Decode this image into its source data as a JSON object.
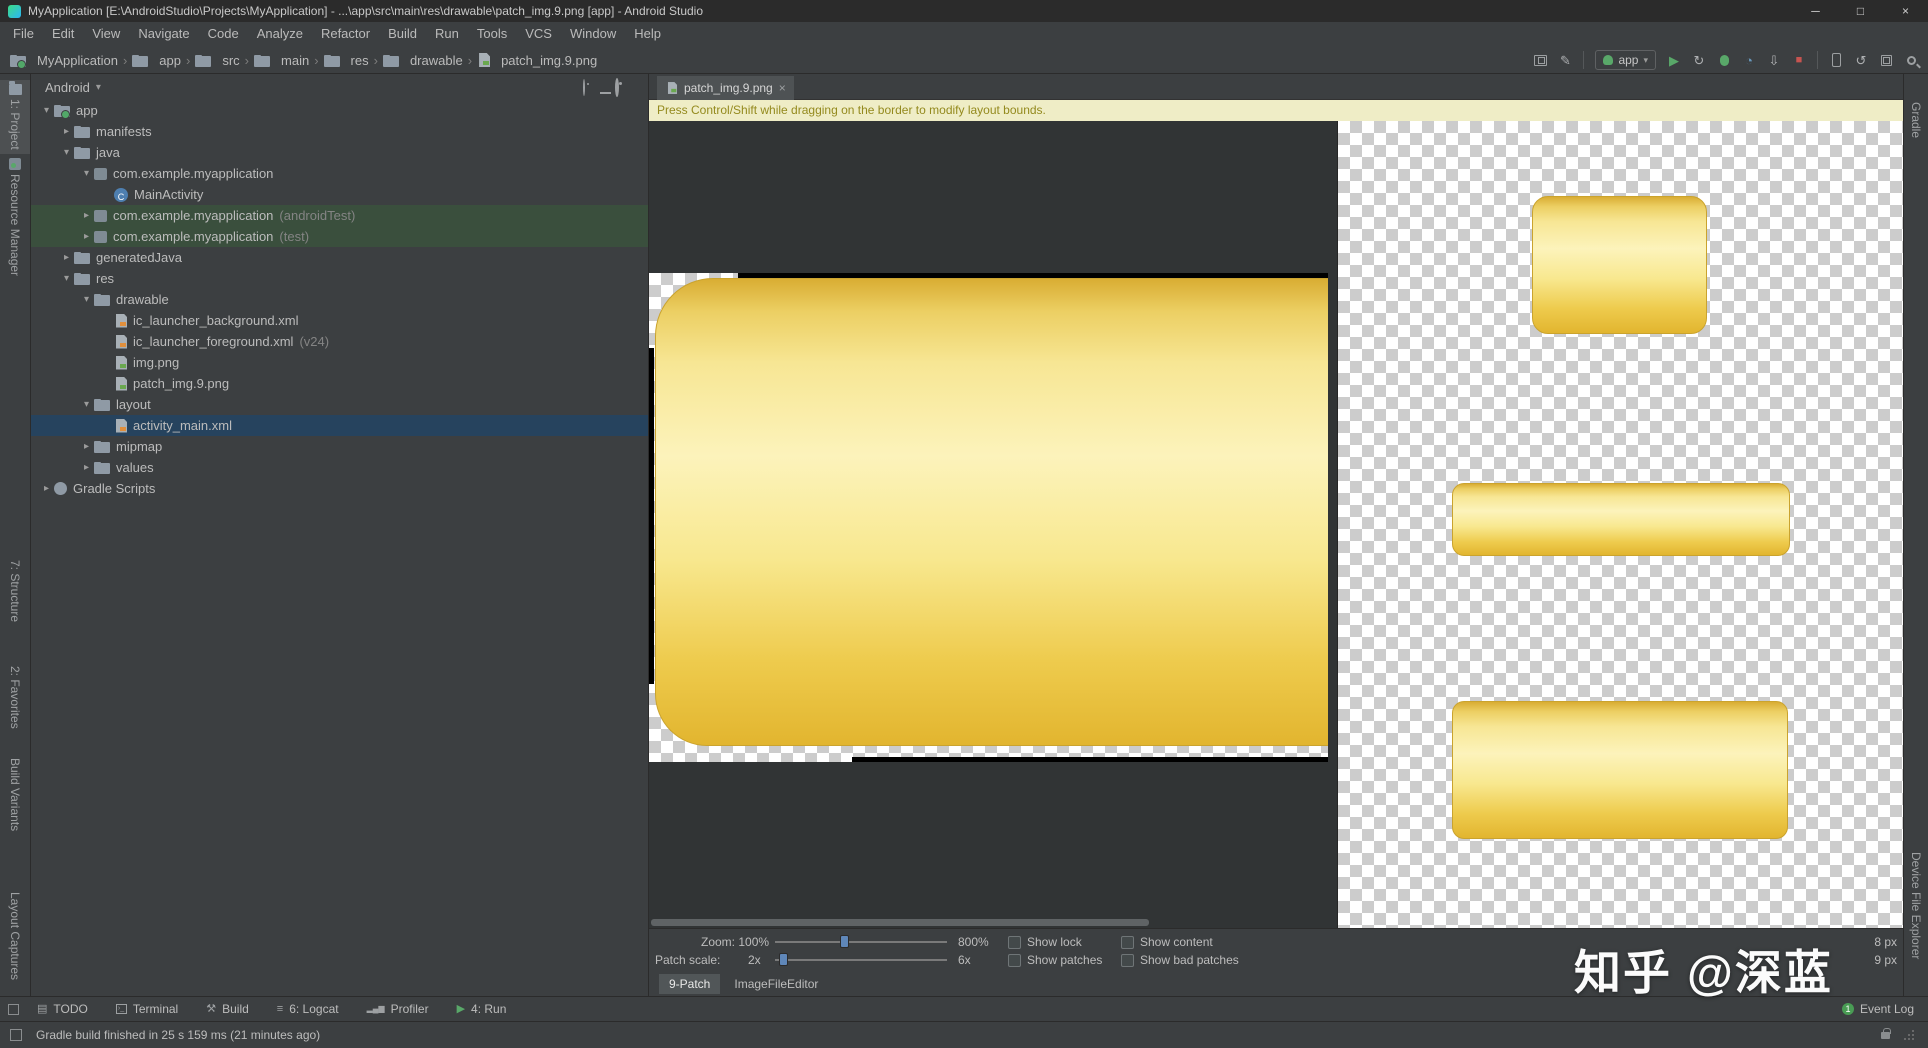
{
  "window": {
    "title": "MyApplication [E:\\AndroidStudio\\Projects\\MyApplication] - ...\\app\\src\\main\\res\\drawable\\patch_img.9.png [app] - Android Studio"
  },
  "glyphs": {
    "chevron": "›",
    "dropdown": "▾",
    "play": "▶",
    "stop": "■",
    "refresh": "↻",
    "sync": "↺",
    "attach": "⇩",
    "gauge": "◔",
    "pencil": "✎",
    "minimize": "─",
    "maximize": "□",
    "close": "×",
    "class_letter": "C",
    "todo": "▤",
    "logcat": "≡",
    "hammer": "⚒",
    "bars": "▂▄▆"
  },
  "menu": {
    "items": [
      "File",
      "Edit",
      "View",
      "Navigate",
      "Code",
      "Analyze",
      "Refactor",
      "Build",
      "Run",
      "Tools",
      "VCS",
      "Window",
      "Help"
    ]
  },
  "toolbar": {
    "breadcrumb": [
      "MyApplication",
      "app",
      "src",
      "main",
      "res",
      "drawable",
      "patch_img.9.png"
    ],
    "run_config": "app"
  },
  "tool_strips": {
    "left_top": [
      "1: Project",
      "Resource Manager"
    ],
    "left_bottom": [
      "7: Structure",
      "2: Favorites",
      "Build Variants",
      "Layout Captures"
    ],
    "right_top": [
      "Gradle"
    ],
    "right_bottom": [
      "Device File Explorer"
    ]
  },
  "project": {
    "selector": "Android",
    "tree": [
      {
        "label": "app",
        "arrow": "▾"
      },
      {
        "label": "manifests",
        "arrow": "▸"
      },
      {
        "label": "java",
        "arrow": "▾"
      },
      {
        "label": "com.example.myapplication",
        "arrow": "▾"
      },
      {
        "label": "MainActivity",
        "arrow": ""
      },
      {
        "label": "com.example.myapplication",
        "badge": "(androidTest)",
        "arrow": "▸"
      },
      {
        "label": "com.example.myapplication",
        "badge": "(test)",
        "arrow": "▸"
      },
      {
        "label": "generatedJava",
        "arrow": "▸"
      },
      {
        "label": "res",
        "arrow": "▾"
      },
      {
        "label": "drawable",
        "arrow": "▾"
      },
      {
        "label": "ic_launcher_background.xml",
        "arrow": ""
      },
      {
        "label": "ic_launcher_foreground.xml",
        "badge": "(v24)",
        "arrow": ""
      },
      {
        "label": "img.png",
        "arrow": ""
      },
      {
        "label": "patch_img.9.png",
        "arrow": ""
      },
      {
        "label": "layout",
        "arrow": "▾"
      },
      {
        "label": "activity_main.xml",
        "arrow": ""
      },
      {
        "label": "mipmap",
        "arrow": "▸"
      },
      {
        "label": "values",
        "arrow": "▸"
      },
      {
        "label": "Gradle Scripts",
        "arrow": "▸"
      }
    ]
  },
  "editor": {
    "tab": {
      "title": "patch_img.9.png"
    },
    "notice": "Press Control/Shift while dragging on the border to modify layout bounds.",
    "controls": {
      "zoom_label": "Zoom:",
      "zoom_value": "100%",
      "zoom_max": "800%",
      "patch_label": "Patch scale:",
      "patch_value": "2x",
      "patch_max": "6x",
      "show_lock": "Show lock",
      "show_content": "Show content",
      "show_patches": "Show patches",
      "show_bad_patches": "Show bad patches",
      "size_width": "8 px",
      "size_height": "9 px"
    },
    "bottom_tabs": [
      "9-Patch",
      "ImageFileEditor"
    ]
  },
  "bottom_bar": {
    "items": [
      "TODO",
      "Terminal",
      "Build",
      "6: Logcat",
      "Profiler",
      "4: Run"
    ],
    "event_log": "Event Log",
    "event_count": "1"
  },
  "status_bar": {
    "message": "Gradle build finished in 25 s 159 ms (21 minutes ago)"
  },
  "watermark": "知乎 @深蓝",
  "colors": {
    "chrome_bg": "#3c3f41",
    "dark_line": "#2b2b2b",
    "selection_blue": "#26435e",
    "test_green": "#3a4f3d",
    "notice_bg": "#efedc6",
    "notice_text": "#948a1e",
    "gold_light": "#fcf3bb",
    "gold_dark": "#e2b52f",
    "run_green": "#59a869",
    "stop_red": "#c75450"
  }
}
